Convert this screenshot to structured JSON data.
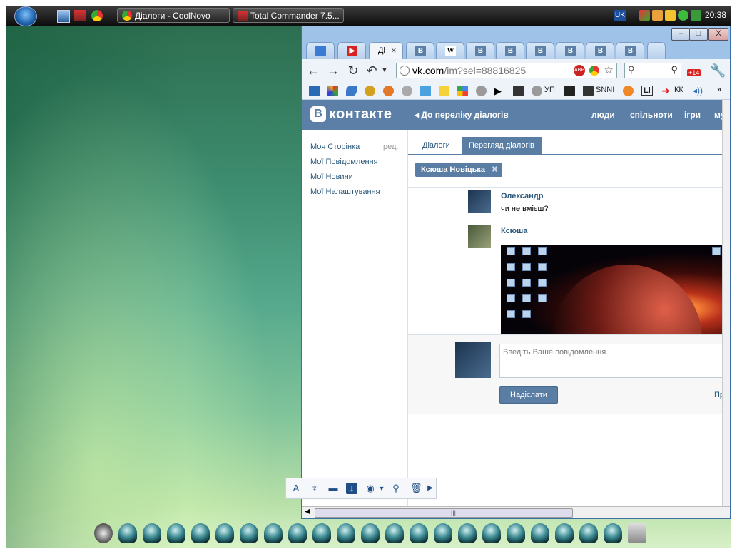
{
  "taskbar": {
    "tasks": [
      {
        "label": "Діалоги - CoolNovo"
      },
      {
        "label": "Total Commander 7.5..."
      }
    ],
    "tray": {
      "language": "UK",
      "clock": "20:38"
    }
  },
  "browser": {
    "window_controls": [
      "–",
      "□",
      "X"
    ],
    "active_tab_label": "Ді",
    "tab_close": "×",
    "tab_favicons": [
      "doc-icon",
      "youtube-icon",
      "active",
      "vk-icon",
      "wikipedia-icon",
      "vk-icon",
      "vk-icon",
      "vk-icon",
      "vk-icon",
      "vk-icon",
      "vk-icon",
      "vk-icon"
    ],
    "tab_letters": {
      "vk": "B",
      "wiki": "W"
    },
    "address": {
      "host": "vk.com",
      "path": "/im?sel=88816825"
    },
    "badge": "+14",
    "bookmarks": [
      {
        "label": "УП"
      },
      {
        "label": "SNNI"
      },
      {
        "label": "Li"
      },
      {
        "label": "КК"
      }
    ],
    "more": "»"
  },
  "vk": {
    "logo_letter": "B",
    "logo_text": "контакте",
    "back_link": "До переліку діалогів",
    "top_menu": [
      "люди",
      "спільноти",
      "ігри",
      "му"
    ],
    "sidebar": [
      {
        "label": "Моя Сторінка",
        "edit": "ред."
      },
      {
        "label": "Мої Повідомлення"
      },
      {
        "label": "Мої Новини"
      },
      {
        "label": "Мої Налаштування"
      }
    ],
    "tabs": [
      {
        "label": "Діалоги"
      },
      {
        "label": "Перегляд діалогів"
      }
    ],
    "chip": {
      "name": "Ксюша Новіцька",
      "close": "✖"
    },
    "messages": [
      {
        "author": "Олександр",
        "text": "чи не вмієш?"
      },
      {
        "author": "Ксюша",
        "text": ""
      }
    ],
    "composer": {
      "placeholder": "Введіть Ваше повідомлення..",
      "send_label": "Надіслати",
      "side_link": "Пр"
    }
  },
  "colors": {
    "vk_blue": "#597da3",
    "link": "#2b587a",
    "header": "#5b7fa6"
  }
}
